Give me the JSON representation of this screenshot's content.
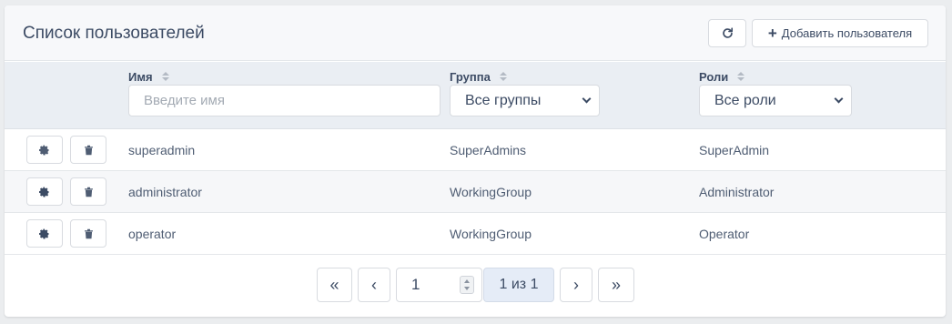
{
  "header": {
    "title": "Список пользователей",
    "refresh_icon": "refresh-icon",
    "add_label": "Добавить пользователя",
    "add_icon": "plus-icon"
  },
  "filters": {
    "columns": [
      "Имя",
      "Группа",
      "Роли"
    ],
    "name_placeholder": "Введите имя",
    "name_value": "",
    "group_selected": "Все группы",
    "roles_selected": "Все роли"
  },
  "rows": [
    {
      "name": "superadmin",
      "group": "SuperAdmins",
      "role": "SuperAdmin"
    },
    {
      "name": "administrator",
      "group": "WorkingGroup",
      "role": "Administrator"
    },
    {
      "name": "operator",
      "group": "WorkingGroup",
      "role": "Operator"
    }
  ],
  "row_icons": {
    "settings": "gear-icon",
    "delete": "trash-icon"
  },
  "pagination": {
    "first": "«",
    "prev": "‹",
    "current_page": "1",
    "info": "1 из 1",
    "next": "›",
    "last": "»"
  },
  "colors": {
    "header_bg": "#f7f8fa",
    "thead_bg": "#eaeef3",
    "text": "#3c4b64",
    "active_page": "#e5ecf7"
  }
}
